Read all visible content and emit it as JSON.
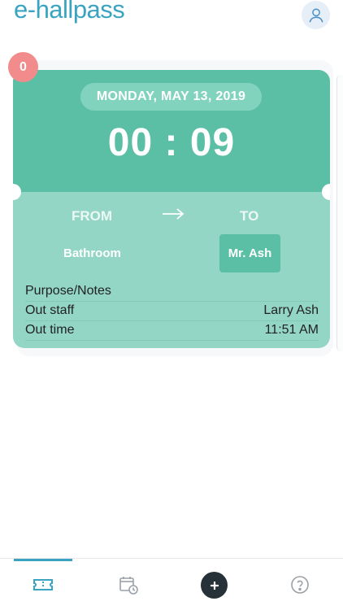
{
  "app": {
    "logo_text": "e-hallpass",
    "brand_color": "#3aa3c2"
  },
  "header": {
    "avatar_icon": "user-icon"
  },
  "pass": {
    "badge_count": "0",
    "date": "MONDAY, MAY 13, 2019",
    "timer": "00 : 09",
    "from_label": "FROM",
    "to_label": "TO",
    "direction_icon": "right-arrow-icon",
    "from_location": "Bathroom",
    "to_location": "Mr. Ash",
    "details": [
      {
        "label": "Purpose/Notes",
        "value": ""
      },
      {
        "label": "Out staff",
        "value": "Larry Ash"
      },
      {
        "label": "Out time",
        "value": "11:51 AM"
      }
    ],
    "colors": {
      "top": "#5bbfa6",
      "bottom": "#93d6c6",
      "badge": "#f28b8b"
    }
  },
  "bottom_nav": {
    "items": [
      {
        "icon": "ticket-icon",
        "active": true
      },
      {
        "icon": "calendar-clock-icon",
        "active": false
      },
      {
        "icon": "plus-icon",
        "active": false
      },
      {
        "icon": "help-icon",
        "active": false
      }
    ]
  }
}
